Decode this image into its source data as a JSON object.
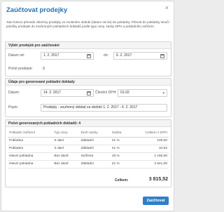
{
  "dialog": {
    "title": "Zaúčtovat prodejky",
    "close": "×",
    "description": "Tato funkce převede všechny prodejky ve zvoleném období (datum od-do) do pokladny. Převod do pokladny sloučí položky prodejek do souhrnných pokladních dokladů podle typu ceny, sazby DPH a pokladního zařízení."
  },
  "selection": {
    "heading": "Výběr prodejek pro zaúčtování",
    "from_label": "Datum od:",
    "from_value": "1. 2. 2017",
    "to_label": "do:",
    "to_value": "6. 2. 2017",
    "count_label": "Počet prodejek:",
    "count_value": "3"
  },
  "doc": {
    "heading": "Údaje pro generované pokladní doklady",
    "date_label": "Datum:",
    "date_value": "14. 2. 2017",
    "vat_label": "Členění DPH:",
    "vat_value": "01-02",
    "desc_label": "Popis:",
    "desc_value": "Prodejky - souhrnný doklad za období 1. 2. 2017 - 6. 2. 2017"
  },
  "summary": {
    "heading": "Počet generovaných pokladních dokladů: 4",
    "columns": [
      "Pokladní zařízení",
      "Typ ceny",
      "Druh sazby",
      "Sazba",
      "Celkem s DPH"
    ],
    "rows": [
      [
        "Pokladna",
        "S daní",
        "Základní",
        "21 %",
        "100,00"
      ],
      [
        "Pokladna",
        "S daní",
        "Základní",
        "21 %",
        "34,52"
      ],
      [
        "Hlavní pokladna",
        "Bez daně",
        "Snížená",
        "15 %",
        "1 150,00"
      ],
      [
        "Hlavní pokladna",
        "Bez daně",
        "Základní",
        "21 %",
        "2 541,00"
      ]
    ],
    "total_label": "Celkem:",
    "total_value": "3 815,52"
  },
  "actions": {
    "ok_label": "Zaúčtovat"
  }
}
